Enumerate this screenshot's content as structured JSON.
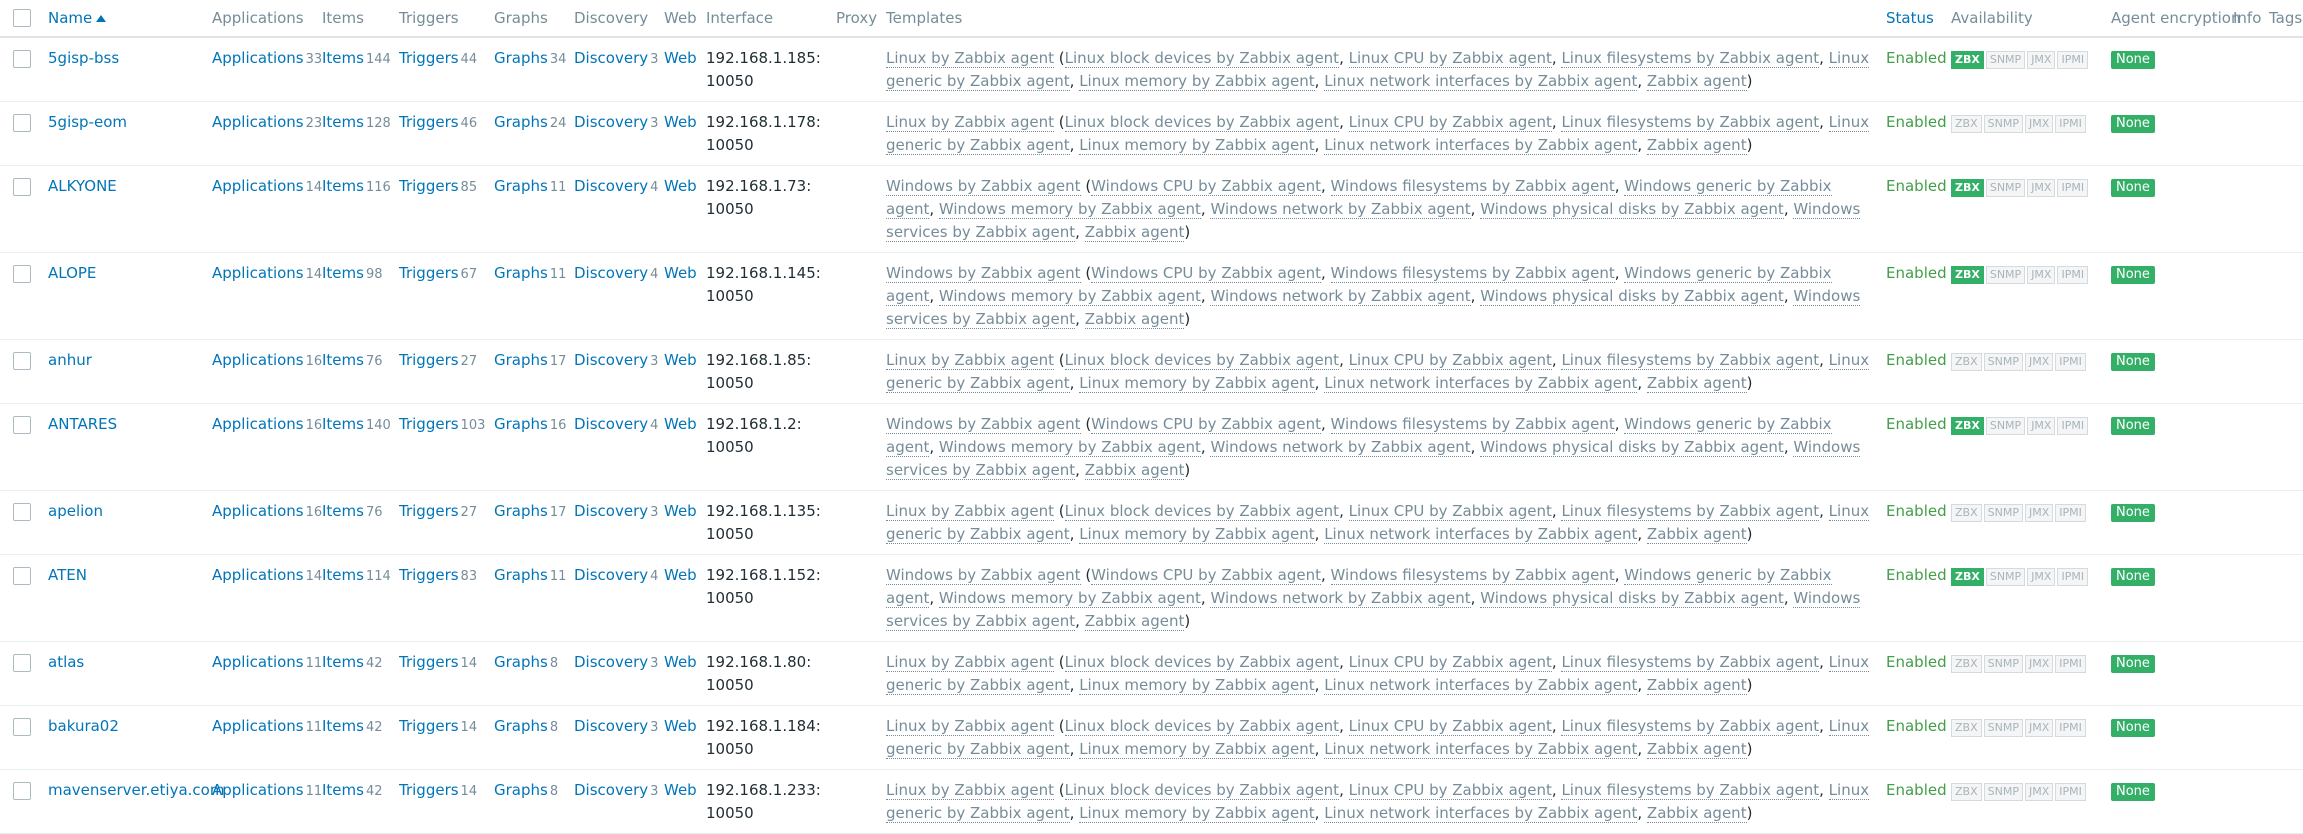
{
  "headers": {
    "name": "Name",
    "applications": "Applications",
    "items": "Items",
    "triggers": "Triggers",
    "graphs": "Graphs",
    "discovery": "Discovery",
    "web": "Web",
    "interface": "Interface",
    "proxy": "Proxy",
    "templates": "Templates",
    "status": "Status",
    "availability": "Availability",
    "agent_encryption": "Agent encryption",
    "info": "Info",
    "tags": "Tags"
  },
  "labels": {
    "applications": "Applications",
    "items": "Items",
    "triggers": "Triggers",
    "graphs": "Graphs",
    "discovery": "Discovery",
    "web": "Web"
  },
  "availability_labels": [
    "ZBX",
    "SNMP",
    "JMX",
    "IPMI"
  ],
  "colors": {
    "link": "#0275b8",
    "enabled": "#429e47",
    "badge_green": "#34af67",
    "muted": "#768d99"
  },
  "template_sets": {
    "linux": {
      "main": "Linux by Zabbix agent",
      "children": [
        "Linux block devices by Zabbix agent",
        "Linux CPU by Zabbix agent",
        "Linux filesystems by Zabbix agent",
        "Linux generic by Zabbix agent",
        "Linux memory by Zabbix agent",
        "Linux network interfaces by Zabbix agent",
        "Zabbix agent"
      ]
    },
    "windows": {
      "main": "Windows by Zabbix agent",
      "children": [
        "Windows CPU by Zabbix agent",
        "Windows filesystems by Zabbix agent",
        "Windows generic by Zabbix agent",
        "Windows memory by Zabbix agent",
        "Windows network by Zabbix agent",
        "Windows physical disks by Zabbix agent",
        "Windows services by Zabbix agent",
        "Zabbix agent"
      ]
    }
  },
  "hosts": [
    {
      "name": "5gisp-bss",
      "applications": "33",
      "items": "144",
      "triggers": "44",
      "graphs": "34",
      "discovery": "3",
      "interface": "192.168.1.185:\n10050",
      "proxy": "",
      "templates": "linux",
      "status": "Enabled",
      "zbx_on": true,
      "encryption": "None"
    },
    {
      "name": "5gisp-eom",
      "applications": "23",
      "items": "128",
      "triggers": "46",
      "graphs": "24",
      "discovery": "3",
      "interface": "192.168.1.178:\n10050",
      "proxy": "",
      "templates": "linux",
      "status": "Enabled",
      "zbx_on": false,
      "encryption": "None"
    },
    {
      "name": "ALKYONE",
      "applications": "14",
      "items": "116",
      "triggers": "85",
      "graphs": "11",
      "discovery": "4",
      "interface": "192.168.1.73:\n10050",
      "proxy": "",
      "templates": "windows",
      "status": "Enabled",
      "zbx_on": true,
      "encryption": "None"
    },
    {
      "name": "ALOPE",
      "applications": "14",
      "items": "98",
      "triggers": "67",
      "graphs": "11",
      "discovery": "4",
      "interface": "192.168.1.145:\n10050",
      "proxy": "",
      "templates": "windows",
      "status": "Enabled",
      "zbx_on": true,
      "encryption": "None"
    },
    {
      "name": "anhur",
      "applications": "16",
      "items": "76",
      "triggers": "27",
      "graphs": "17",
      "discovery": "3",
      "interface": "192.168.1.85:\n10050",
      "proxy": "",
      "templates": "linux",
      "status": "Enabled",
      "zbx_on": false,
      "encryption": "None"
    },
    {
      "name": "ANTARES",
      "applications": "16",
      "items": "140",
      "triggers": "103",
      "graphs": "16",
      "discovery": "4",
      "interface": "192.168.1.2:\n10050",
      "proxy": "",
      "templates": "windows",
      "status": "Enabled",
      "zbx_on": true,
      "encryption": "None"
    },
    {
      "name": "apelion",
      "applications": "16",
      "items": "76",
      "triggers": "27",
      "graphs": "17",
      "discovery": "3",
      "interface": "192.168.1.135:\n10050",
      "proxy": "",
      "templates": "linux",
      "status": "Enabled",
      "zbx_on": false,
      "encryption": "None"
    },
    {
      "name": "ATEN",
      "applications": "14",
      "items": "114",
      "triggers": "83",
      "graphs": "11",
      "discovery": "4",
      "interface": "192.168.1.152:\n10050",
      "proxy": "",
      "templates": "windows",
      "status": "Enabled",
      "zbx_on": true,
      "encryption": "None"
    },
    {
      "name": "atlas",
      "applications": "11",
      "items": "42",
      "triggers": "14",
      "graphs": "8",
      "discovery": "3",
      "interface": "192.168.1.80:\n10050",
      "proxy": "",
      "templates": "linux",
      "status": "Enabled",
      "zbx_on": false,
      "encryption": "None"
    },
    {
      "name": "bakura02",
      "applications": "11",
      "items": "42",
      "triggers": "14",
      "graphs": "8",
      "discovery": "3",
      "interface": "192.168.1.184:\n10050",
      "proxy": "",
      "templates": "linux",
      "status": "Enabled",
      "zbx_on": false,
      "encryption": "None"
    },
    {
      "name": "mavenserver.etiya.com",
      "applications": "11",
      "items": "42",
      "triggers": "14",
      "graphs": "8",
      "discovery": "3",
      "interface": "192.168.1.233:\n10050",
      "proxy": "",
      "templates": "linux",
      "status": "Enabled",
      "zbx_on": false,
      "encryption": "None"
    }
  ]
}
